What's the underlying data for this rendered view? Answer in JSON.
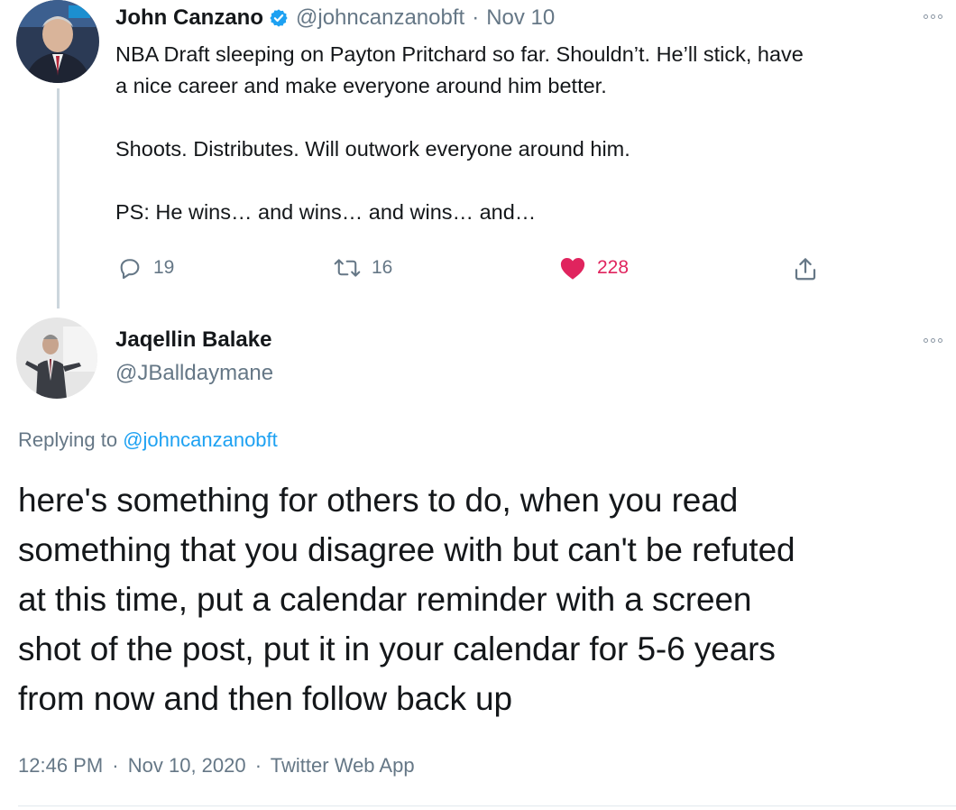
{
  "parent_tweet": {
    "author_name": "John Canzano",
    "handle": "@johncanzanobft",
    "separator": "·",
    "date": "Nov 10",
    "verified": true,
    "text_lines": [
      "NBA Draft sleeping on Payton Pritchard so far. Shouldn’t. He’ll stick, have",
      "a nice career and make everyone around him better.",
      "Shoots. Distributes. Will outwork everyone around him.",
      "PS: He wins… and wins… and wins… and…"
    ],
    "replies": "19",
    "retweets": "16",
    "likes": "228",
    "like_color": "#e0245e"
  },
  "reply_tweet": {
    "author_name": "Jaqellin Balake",
    "handle": "@JBalldaymane",
    "replying_label": "Replying to",
    "replying_to": "@johncanzanobft",
    "text_lines": [
      "here's something for others to do, when you read",
      "something that you disagree with but can't be refuted",
      "at this time, put a calendar reminder with a screen",
      "shot of the post, put it in your calendar for 5-6 years",
      "from now and then follow back up"
    ],
    "time": "12:46 PM",
    "separator": "·",
    "date": "Nov 10, 2020",
    "source": "Twitter Web App"
  },
  "colors": {
    "accent": "#1da1f2",
    "secondary_text": "#657786",
    "like": "#e0245e"
  },
  "icons": [
    "more-icon",
    "verified-badge-icon",
    "reply-icon",
    "retweet-icon",
    "heart-icon",
    "share-icon"
  ]
}
